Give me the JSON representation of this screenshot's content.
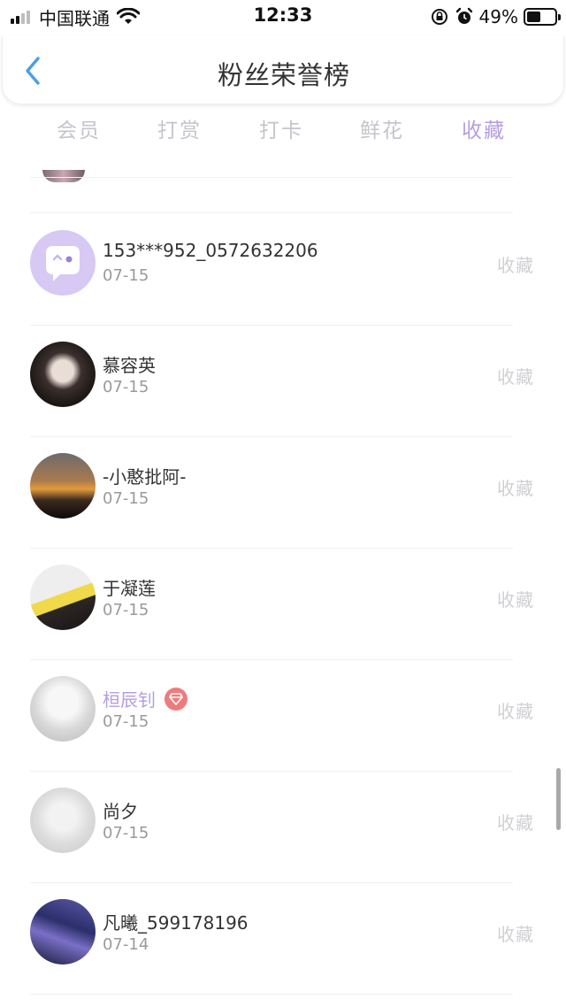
{
  "status_bar": {
    "carrier": "中国联通",
    "time": "12:33",
    "battery_percent": "49%",
    "battery_level": 0.49,
    "signal_bars": 4,
    "signal_active": 2
  },
  "nav": {
    "title": "粉丝荣誉榜",
    "back_icon": "chevron-left-icon"
  },
  "tabs": [
    {
      "label": "会员",
      "active": false
    },
    {
      "label": "打赏",
      "active": false
    },
    {
      "label": "打卡",
      "active": false
    },
    {
      "label": "鲜花",
      "active": false
    },
    {
      "label": "收藏",
      "active": true
    }
  ],
  "rows": [
    {
      "name": "153***952_0572632206",
      "date": "07-15",
      "action": "收藏",
      "vip": false
    },
    {
      "name": "慕容英",
      "date": "07-15",
      "action": "收藏",
      "vip": false
    },
    {
      "name": "-小憨批阿-",
      "date": "07-15",
      "action": "收藏",
      "vip": false
    },
    {
      "name": "于凝莲",
      "date": "07-15",
      "action": "收藏",
      "vip": false
    },
    {
      "name": "桓辰钊",
      "date": "07-15",
      "action": "收藏",
      "vip": true
    },
    {
      "name": "尚夕",
      "date": "07-15",
      "action": "收藏",
      "vip": false
    },
    {
      "name": "凡曦_599178196",
      "date": "07-14",
      "action": "收藏",
      "vip": false
    }
  ],
  "colors": {
    "accent": "#b49ee0",
    "vip_badge": "#ec7c7c",
    "inactive_tab": "#c4c4cc",
    "action_text": "#d0d0d4"
  }
}
